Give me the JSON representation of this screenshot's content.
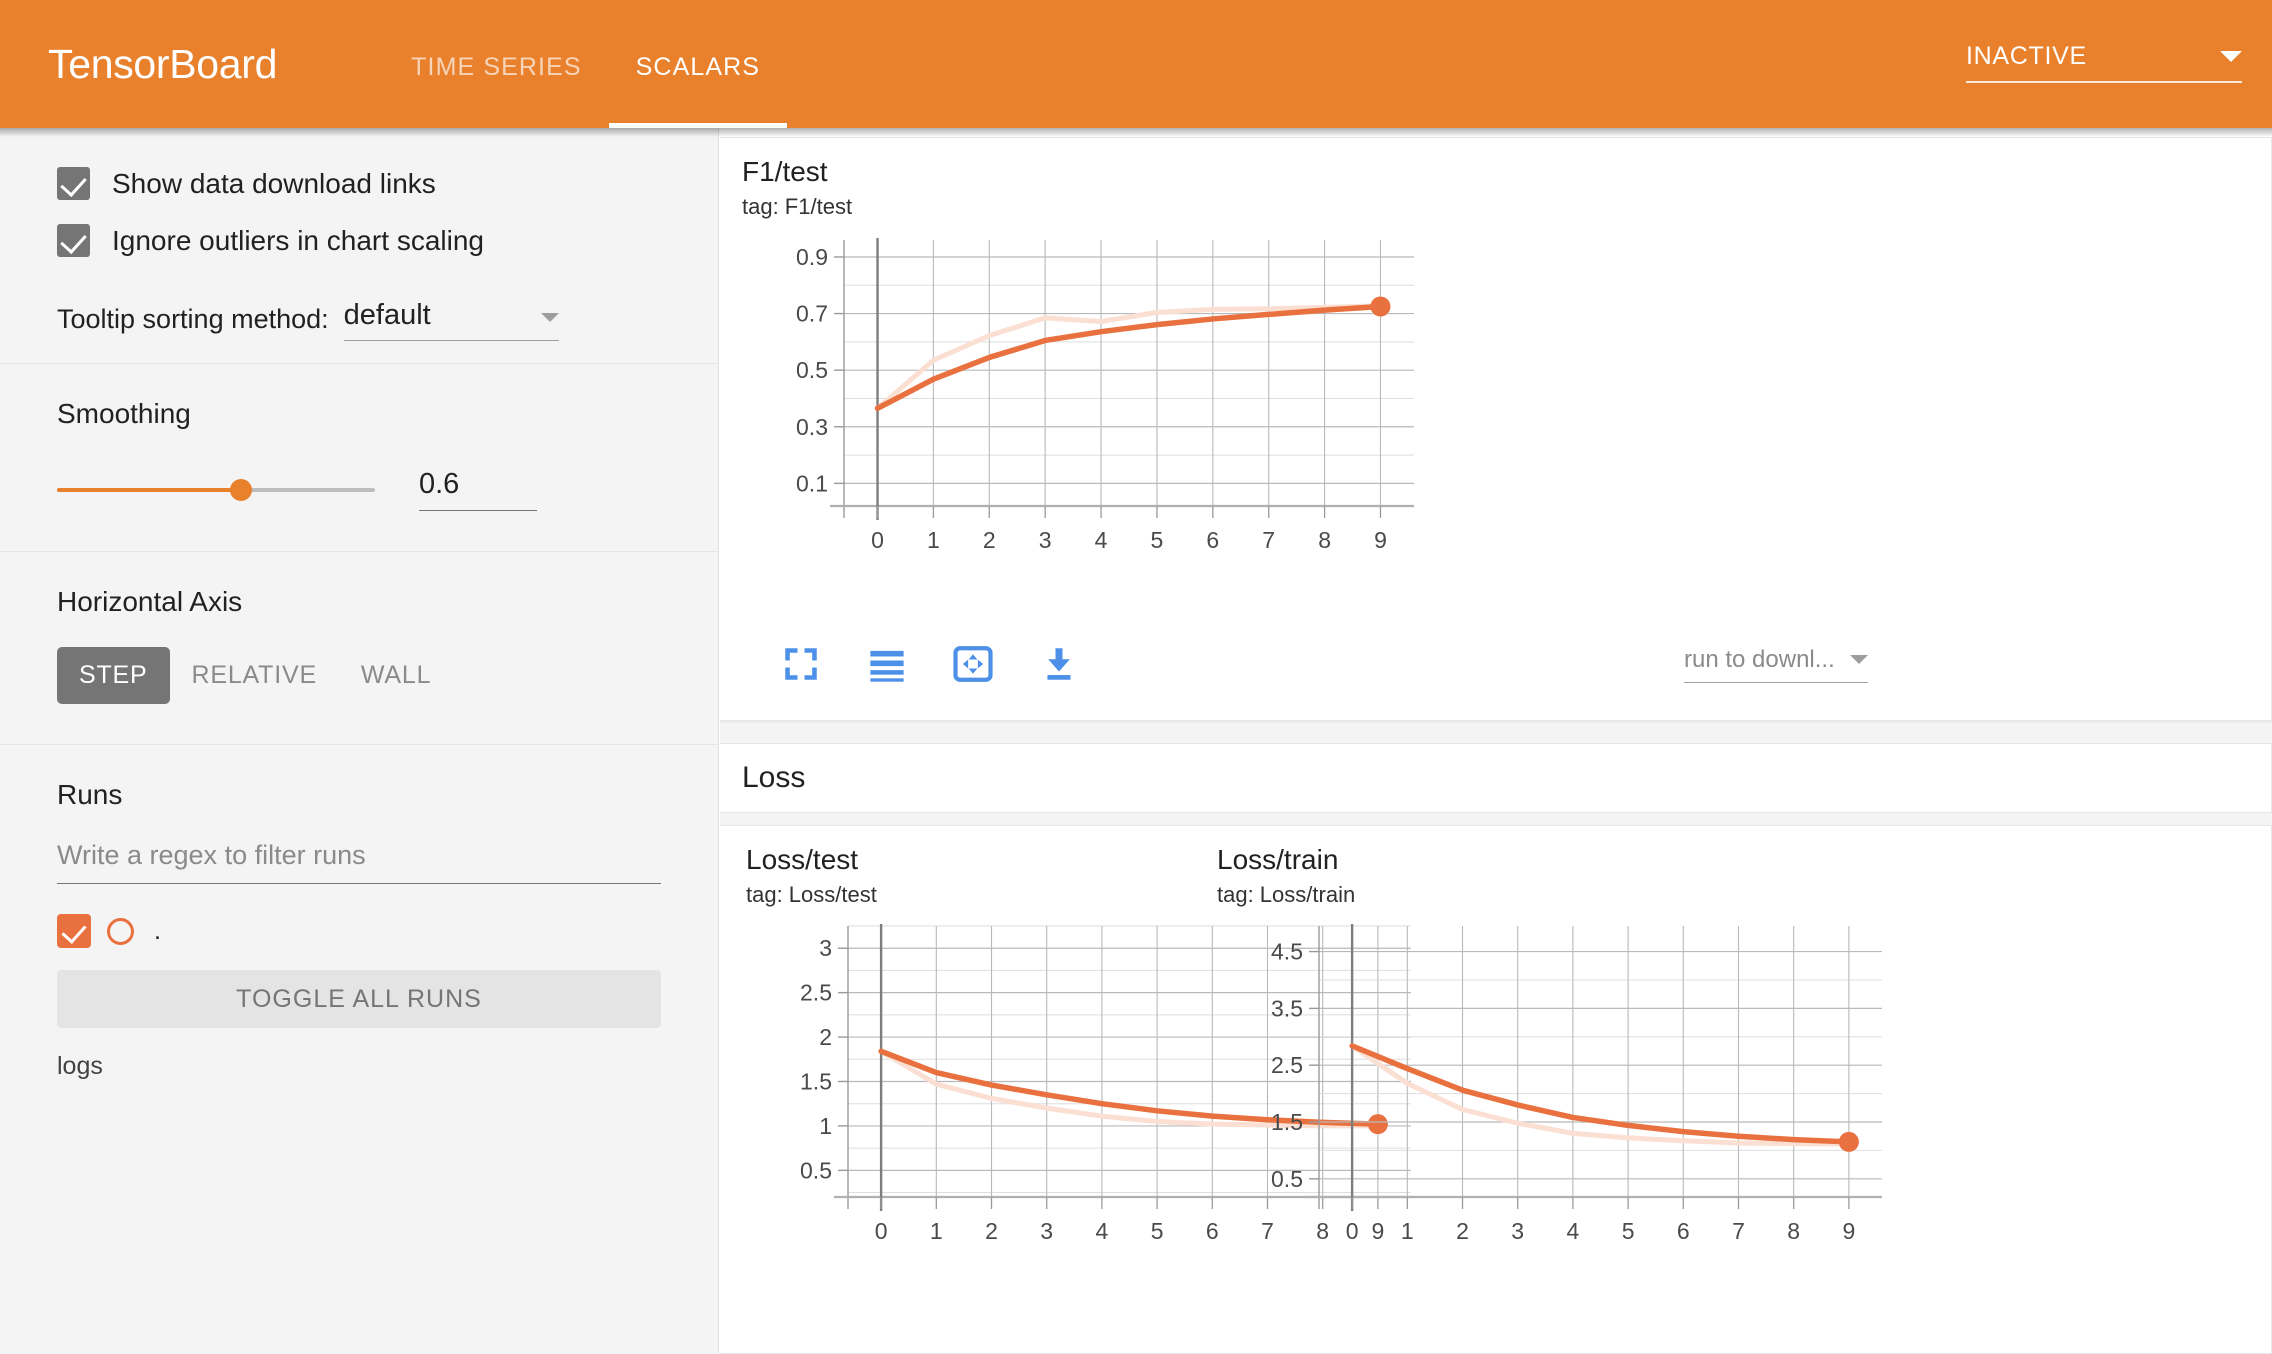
{
  "app": {
    "title": "TensorBoard",
    "accent_color": "#e8802c",
    "series_color": "#e9713f",
    "series_color_faded": "#fadfd2",
    "icon_blue": "#4d90e8"
  },
  "topbar": {
    "tabs": [
      {
        "label": "TIME SERIES",
        "active": false
      },
      {
        "label": "SCALARS",
        "active": true
      }
    ],
    "status_selector": {
      "value": "INACTIVE",
      "icon": "chevron-down-icon"
    }
  },
  "sidebar": {
    "checkboxes": [
      {
        "label": "Show data download links",
        "checked": true
      },
      {
        "label": "Ignore outliers in chart scaling",
        "checked": true
      }
    ],
    "tooltip_sort": {
      "label": "Tooltip sorting method:",
      "value": "default",
      "icon": "chevron-down-icon"
    },
    "smoothing": {
      "title": "Smoothing",
      "value": "0.6",
      "slider_percent": 58
    },
    "horizontal_axis": {
      "title": "Horizontal Axis",
      "options": [
        {
          "label": "STEP",
          "active": true
        },
        {
          "label": "RELATIVE",
          "active": false
        },
        {
          "label": "WALL",
          "active": false
        }
      ]
    },
    "runs": {
      "title": "Runs",
      "filter_placeholder": "Write a regex to filter runs",
      "filter_value": "",
      "items": [
        {
          "name": ".",
          "checked": true
        }
      ],
      "toggle_all_label": "TOGGLE ALL RUNS",
      "footer_label": "logs"
    }
  },
  "main": {
    "section_header": "Loss",
    "chart_toolbar": {
      "icons": [
        "fullscreen-icon",
        "line-style-icon",
        "fit-domain-icon",
        "download-icon"
      ],
      "download_select": {
        "value": "run to downl...",
        "icon": "chevron-down-icon"
      }
    }
  },
  "chart_data": [
    {
      "id": "f1-test",
      "type": "line",
      "title": "F1/test",
      "tag": "tag: F1/test",
      "xlabel": "",
      "ylabel": "",
      "x": [
        0,
        1,
        2,
        3,
        4,
        5,
        6,
        7,
        8,
        9
      ],
      "xlim": [
        -0.6,
        9.6
      ],
      "ylim": [
        0.02,
        0.96
      ],
      "xticks": [
        "0",
        "1",
        "2",
        "3",
        "4",
        "5",
        "6",
        "7",
        "8",
        "9"
      ],
      "yticks": [
        "0.1",
        "0.3",
        "0.5",
        "0.7",
        "0.9"
      ],
      "ytick_values": [
        0.1,
        0.3,
        0.5,
        0.7,
        0.9
      ],
      "grid": true,
      "series": [
        {
          "name": ".",
          "style": "raw",
          "values": [
            0.365,
            0.535,
            0.622,
            0.685,
            0.672,
            0.704,
            0.715,
            0.717,
            0.722,
            0.727
          ]
        },
        {
          "name": ".",
          "style": "smoothed",
          "values": [
            0.365,
            0.468,
            0.545,
            0.605,
            0.636,
            0.661,
            0.681,
            0.697,
            0.712,
            0.725
          ],
          "last_point_marker": true
        }
      ]
    },
    {
      "id": "loss-test",
      "type": "line",
      "title": "Loss/test",
      "tag": "tag: Loss/test",
      "xlabel": "",
      "ylabel": "",
      "x": [
        0,
        1,
        2,
        3,
        4,
        5,
        6,
        7,
        8,
        9
      ],
      "xlim": [
        -0.6,
        9.6
      ],
      "ylim": [
        0.2,
        3.25
      ],
      "xticks": [
        "0",
        "1",
        "2",
        "3",
        "4",
        "5",
        "6",
        "7",
        "8",
        "9"
      ],
      "yticks": [
        "0.5",
        "1",
        "1.5",
        "2",
        "2.5",
        "3"
      ],
      "ytick_values": [
        0.5,
        1.0,
        1.5,
        2.0,
        2.5,
        3.0
      ],
      "grid": true,
      "series": [
        {
          "name": ".",
          "style": "raw",
          "values": [
            1.84,
            1.47,
            1.31,
            1.2,
            1.11,
            1.05,
            1.02,
            1.01,
            1.0,
            1.0
          ]
        },
        {
          "name": ".",
          "style": "smoothed",
          "values": [
            1.84,
            1.6,
            1.46,
            1.35,
            1.25,
            1.17,
            1.11,
            1.07,
            1.04,
            1.02
          ],
          "last_point_marker": true
        }
      ]
    },
    {
      "id": "loss-train",
      "type": "line",
      "title": "Loss/train",
      "tag": "tag: Loss/train",
      "xlabel": "",
      "ylabel": "",
      "x": [
        0,
        1,
        2,
        3,
        4,
        5,
        6,
        7,
        8,
        9
      ],
      "xlim": [
        -0.6,
        9.6
      ],
      "ylim": [
        0.18,
        4.95
      ],
      "xticks": [
        "0",
        "1",
        "2",
        "3",
        "4",
        "5",
        "6",
        "7",
        "8",
        "9"
      ],
      "yticks": [
        "0.5",
        "1.5",
        "2.5",
        "3.5",
        "4.5"
      ],
      "ytick_values": [
        0.5,
        1.5,
        2.5,
        3.5,
        4.5
      ],
      "grid": true,
      "series": [
        {
          "name": ".",
          "style": "raw",
          "values": [
            2.84,
            2.18,
            1.72,
            1.48,
            1.3,
            1.22,
            1.17,
            1.13,
            1.12,
            1.11
          ]
        },
        {
          "name": ".",
          "style": "smoothed",
          "values": [
            2.84,
            2.44,
            2.06,
            1.8,
            1.58,
            1.44,
            1.33,
            1.25,
            1.19,
            1.15
          ],
          "last_point_marker": true
        }
      ]
    }
  ]
}
